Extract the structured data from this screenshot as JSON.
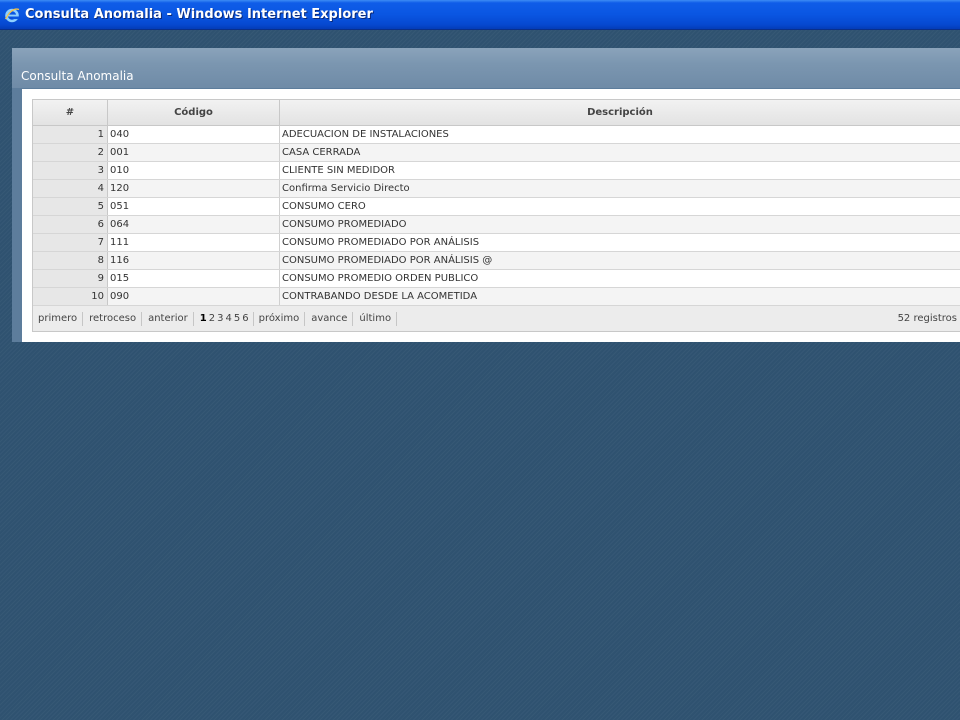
{
  "window": {
    "title": "Consulta Anomalia - Windows Internet Explorer",
    "icon": "internet-explorer-icon"
  },
  "panel": {
    "title": "Consulta Anomalia"
  },
  "grid": {
    "columns": [
      "#",
      "Código",
      "Descripción"
    ],
    "rows": [
      {
        "num": "1",
        "code": "040",
        "desc": "ADECUACION DE INSTALACIONES"
      },
      {
        "num": "2",
        "code": "001",
        "desc": "CASA CERRADA"
      },
      {
        "num": "3",
        "code": "010",
        "desc": "CLIENTE SIN MEDIDOR"
      },
      {
        "num": "4",
        "code": "120",
        "desc": "Confirma Servicio Directo"
      },
      {
        "num": "5",
        "code": "051",
        "desc": "CONSUMO CERO"
      },
      {
        "num": "6",
        "code": "064",
        "desc": "CONSUMO PROMEDIADO"
      },
      {
        "num": "7",
        "code": "111",
        "desc": "CONSUMO PROMEDIADO POR ANÁLISIS"
      },
      {
        "num": "8",
        "code": "116",
        "desc": "CONSUMO PROMEDIADO POR ANÁLISIS @"
      },
      {
        "num": "9",
        "code": "015",
        "desc": "CONSUMO PROMEDIO ORDEN PUBLICO"
      },
      {
        "num": "10",
        "code": "090",
        "desc": "CONTRABANDO DESDE LA ACOMETIDA"
      }
    ]
  },
  "pager": {
    "first": "primero",
    "rewind": "retroceso",
    "prev": "anterior",
    "pages": [
      "1",
      "2",
      "3",
      "4",
      "5",
      "6"
    ],
    "current_page": "1",
    "next": "próximo",
    "forward": "avance",
    "last": "último",
    "count": "52 registros"
  },
  "colors": {
    "desktop_bg": "#2f5270",
    "titlebar_blue": "#0a56e2",
    "panel_header": "#7b96b0"
  }
}
